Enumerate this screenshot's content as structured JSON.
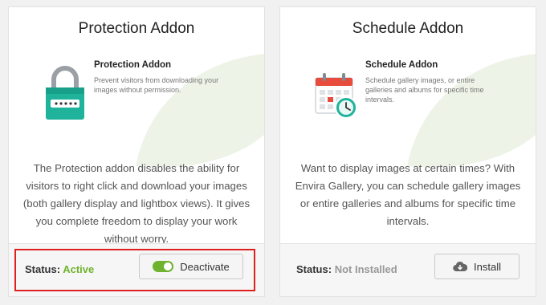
{
  "cards": [
    {
      "title": "Protection Addon",
      "feature_title": "Protection Addon",
      "feature_desc": "Prevent visitors from downloading your images without permission.",
      "description": "The Protection addon disables the ability for visitors to right click and download your images (both gallery display and lightbox views). It gives you complete freedom to display your work without worry.",
      "status_label": "Status:",
      "status_value": "Active",
      "button_label": "Deactivate",
      "icon": "lock-icon"
    },
    {
      "title": "Schedule Addon",
      "feature_title": "Schedule Addon",
      "feature_desc": "Schedule gallery images, or entire galleries and albums for specific time intervals.",
      "description": "Want to display images at certain times? With Envira Gallery, you can schedule gallery images or entire galleries and albums for specific time intervals.",
      "status_label": "Status:",
      "status_value": "Not Installed",
      "button_label": "Install",
      "icon": "calendar-clock-icon"
    }
  ],
  "colors": {
    "active_status": "#6fb22e",
    "inactive_status": "#999999",
    "highlight_border": "#e02020",
    "lock_teal": "#1fb39b",
    "calendar_red": "#e74c3c"
  }
}
